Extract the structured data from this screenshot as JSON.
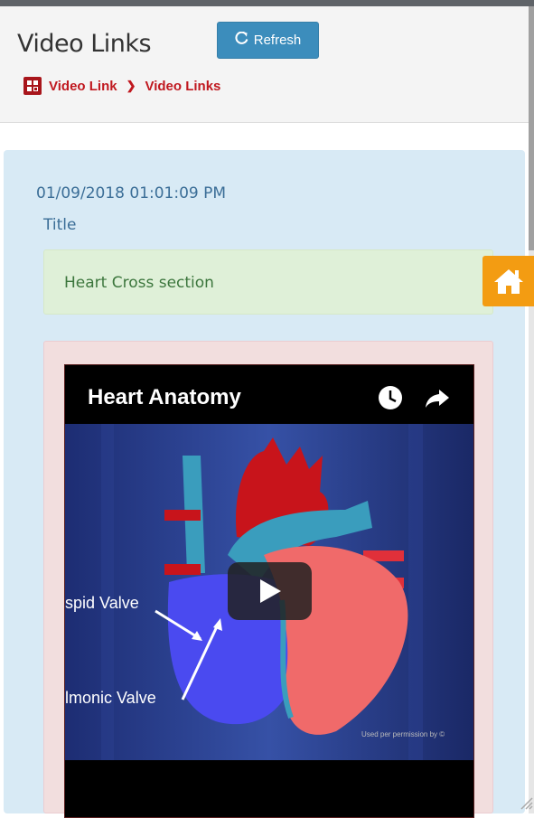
{
  "header": {
    "title": "Video Links",
    "refresh_label": "Refresh"
  },
  "breadcrumb": {
    "items": [
      "Video Link",
      "Video Links"
    ],
    "separator": "❯"
  },
  "entry": {
    "timestamp": "01/09/2018 01:01:09 PM",
    "title_label": "Title",
    "title_value": "Heart Cross section"
  },
  "video": {
    "title": "Heart Anatomy",
    "labels": [
      "spid Valve",
      "lmonic Valve"
    ],
    "credit": "Used per permission by ©",
    "icons": [
      "clock-icon",
      "share-icon",
      "play-icon"
    ]
  },
  "colors": {
    "header_bg": "#f4f4f4",
    "refresh_button": "#3c8dbc",
    "breadcrumb_red": "#c0181f",
    "panel_bg": "#d8eaf5",
    "title_box_bg": "#dff0d8",
    "video_box_bg": "#f2dede",
    "home_button": "#f39c12"
  }
}
